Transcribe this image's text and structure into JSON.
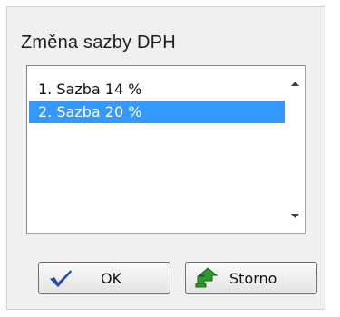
{
  "dialog": {
    "title": "Změna sazby DPH"
  },
  "list": {
    "items": [
      {
        "label": "1. Sazba 14 %",
        "selected": false
      },
      {
        "label": "2. Sazba 20 %",
        "selected": true
      }
    ]
  },
  "buttons": {
    "ok_label": "OK",
    "cancel_label": "Storno",
    "ok_icon": "checkmark-icon",
    "cancel_icon": "undo-arrow-icon"
  },
  "colors": {
    "selection": "#3399ff",
    "dialog_bg": "#f0f0f0",
    "ok_check": "#2a46b8",
    "storno_icon": "#2e9a2e"
  }
}
